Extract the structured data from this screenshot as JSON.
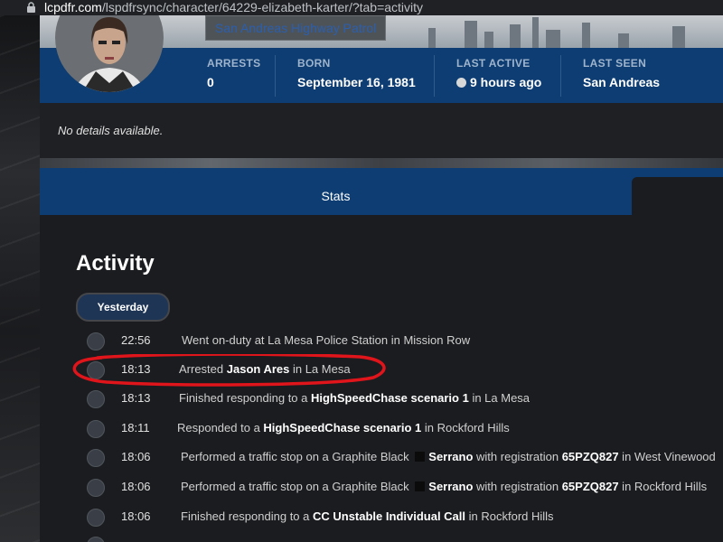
{
  "browser": {
    "domain": "lcpdfr.com",
    "path": "/lspdfrsync/character/64229-elizabeth-karter/?tab=activity"
  },
  "profile": {
    "agency": "San Andreas Highway Patrol",
    "stats": [
      {
        "label": "ARRESTS",
        "value": "0"
      },
      {
        "label": "BORN",
        "value": "September 16, 1981"
      },
      {
        "label": "LAST ACTIVE",
        "value": "9 hours ago"
      },
      {
        "label": "LAST SEEN",
        "value": "San Andreas"
      }
    ]
  },
  "details": {
    "text": "No details available."
  },
  "tabs": {
    "stats_label": "Stats"
  },
  "activity": {
    "heading": "Activity",
    "day_label": "Yesterday",
    "rows": [
      {
        "time": "22:56",
        "parts": [
          "Went on-duty at La Mesa Police Station in Mission Row"
        ]
      },
      {
        "time": "18:13",
        "parts": [
          "Arrested ",
          "Jason Ares",
          " in La Mesa"
        ]
      },
      {
        "time": "18:13",
        "parts": [
          "Finished responding to a ",
          "HighSpeedChase scenario 1",
          " in La Mesa"
        ]
      },
      {
        "time": "18:11",
        "parts": [
          "Responded to a ",
          "HighSpeedChase scenario 1",
          " in Rockford Hills"
        ]
      },
      {
        "time": "18:06",
        "parts": [
          "Performed a traffic stop on a Graphite Black ",
          "Serrano",
          " with registration ",
          "65PZQ827",
          " in West Vinewood"
        ]
      },
      {
        "time": "18:06",
        "parts": [
          "Performed a traffic stop on a Graphite Black ",
          "Serrano",
          " with registration ",
          "65PZQ827",
          " in Rockford Hills"
        ]
      },
      {
        "time": "18:06",
        "parts": [
          "Finished responding to a ",
          "CC Unstable Individual Call",
          " in Rockford Hills"
        ]
      }
    ]
  },
  "colors": {
    "accent_blue": "#0d3d72",
    "annotation_red": "#e0141b"
  }
}
